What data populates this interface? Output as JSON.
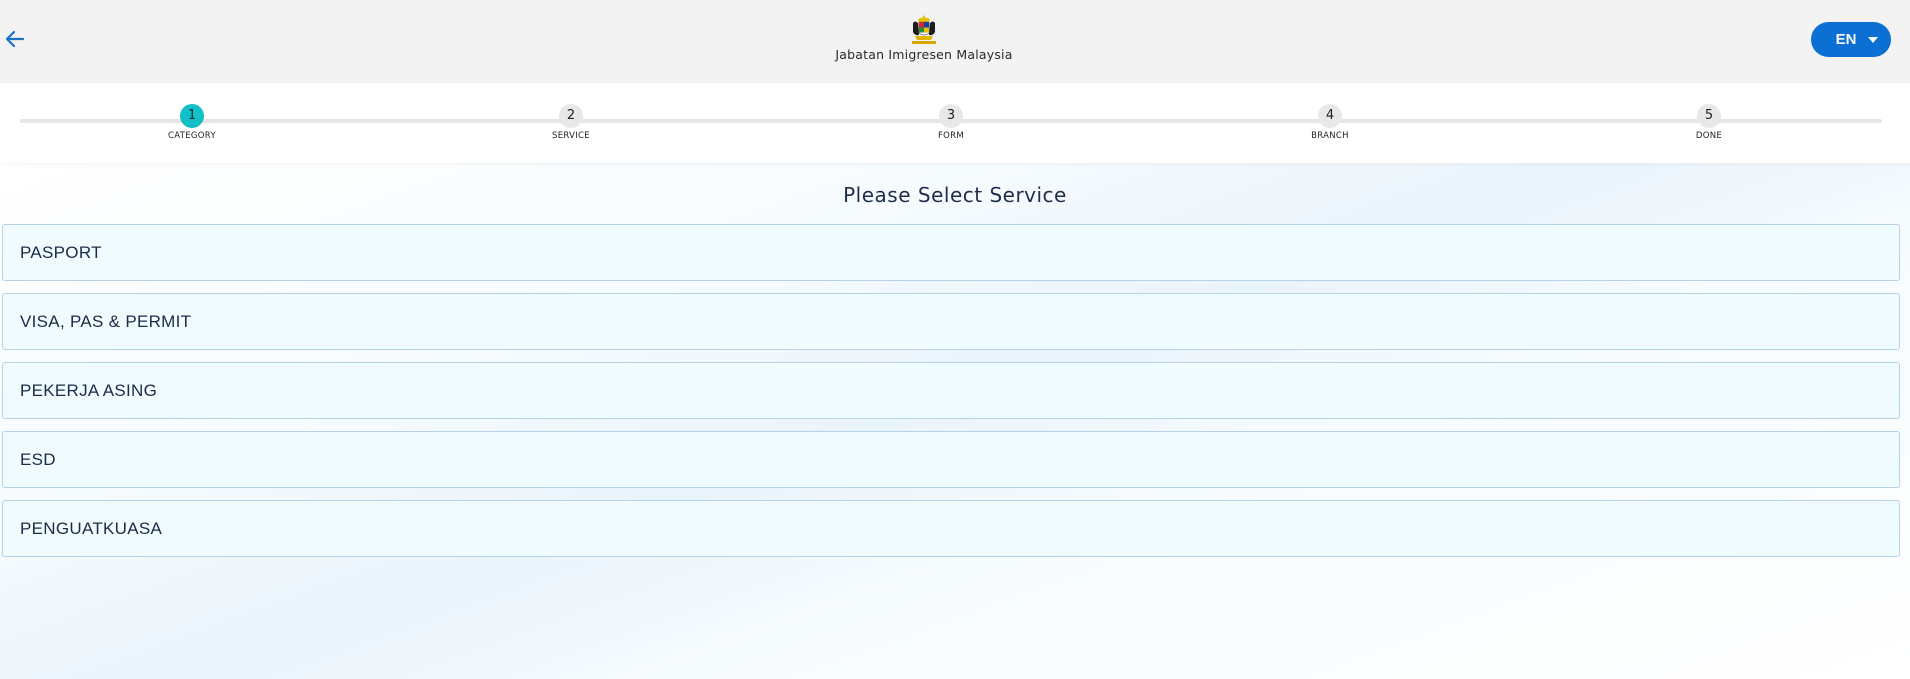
{
  "header": {
    "back_icon": "arrow-left-icon",
    "crest_icon": "malaysia-crest-icon",
    "agency_name": "Jabatan Imigresen Malaysia",
    "language": "EN",
    "language_caret_icon": "caret-down-icon",
    "accent_color": "#0b6fd3"
  },
  "stepper": {
    "active_step": 1,
    "active_color": "#14c0c8",
    "steps": [
      {
        "number": "1",
        "label": "CATEGORY"
      },
      {
        "number": "2",
        "label": "SERVICE"
      },
      {
        "number": "3",
        "label": "FORM"
      },
      {
        "number": "4",
        "label": "BRANCH"
      },
      {
        "number": "5",
        "label": "DONE"
      }
    ]
  },
  "main": {
    "title": "Please Select Service",
    "services": [
      {
        "label": "PASPORT"
      },
      {
        "label": "VISA, PAS & PERMIT"
      },
      {
        "label": "PEKERJA ASING"
      },
      {
        "label": "ESD"
      },
      {
        "label": "PENGUATKUASA"
      }
    ]
  }
}
